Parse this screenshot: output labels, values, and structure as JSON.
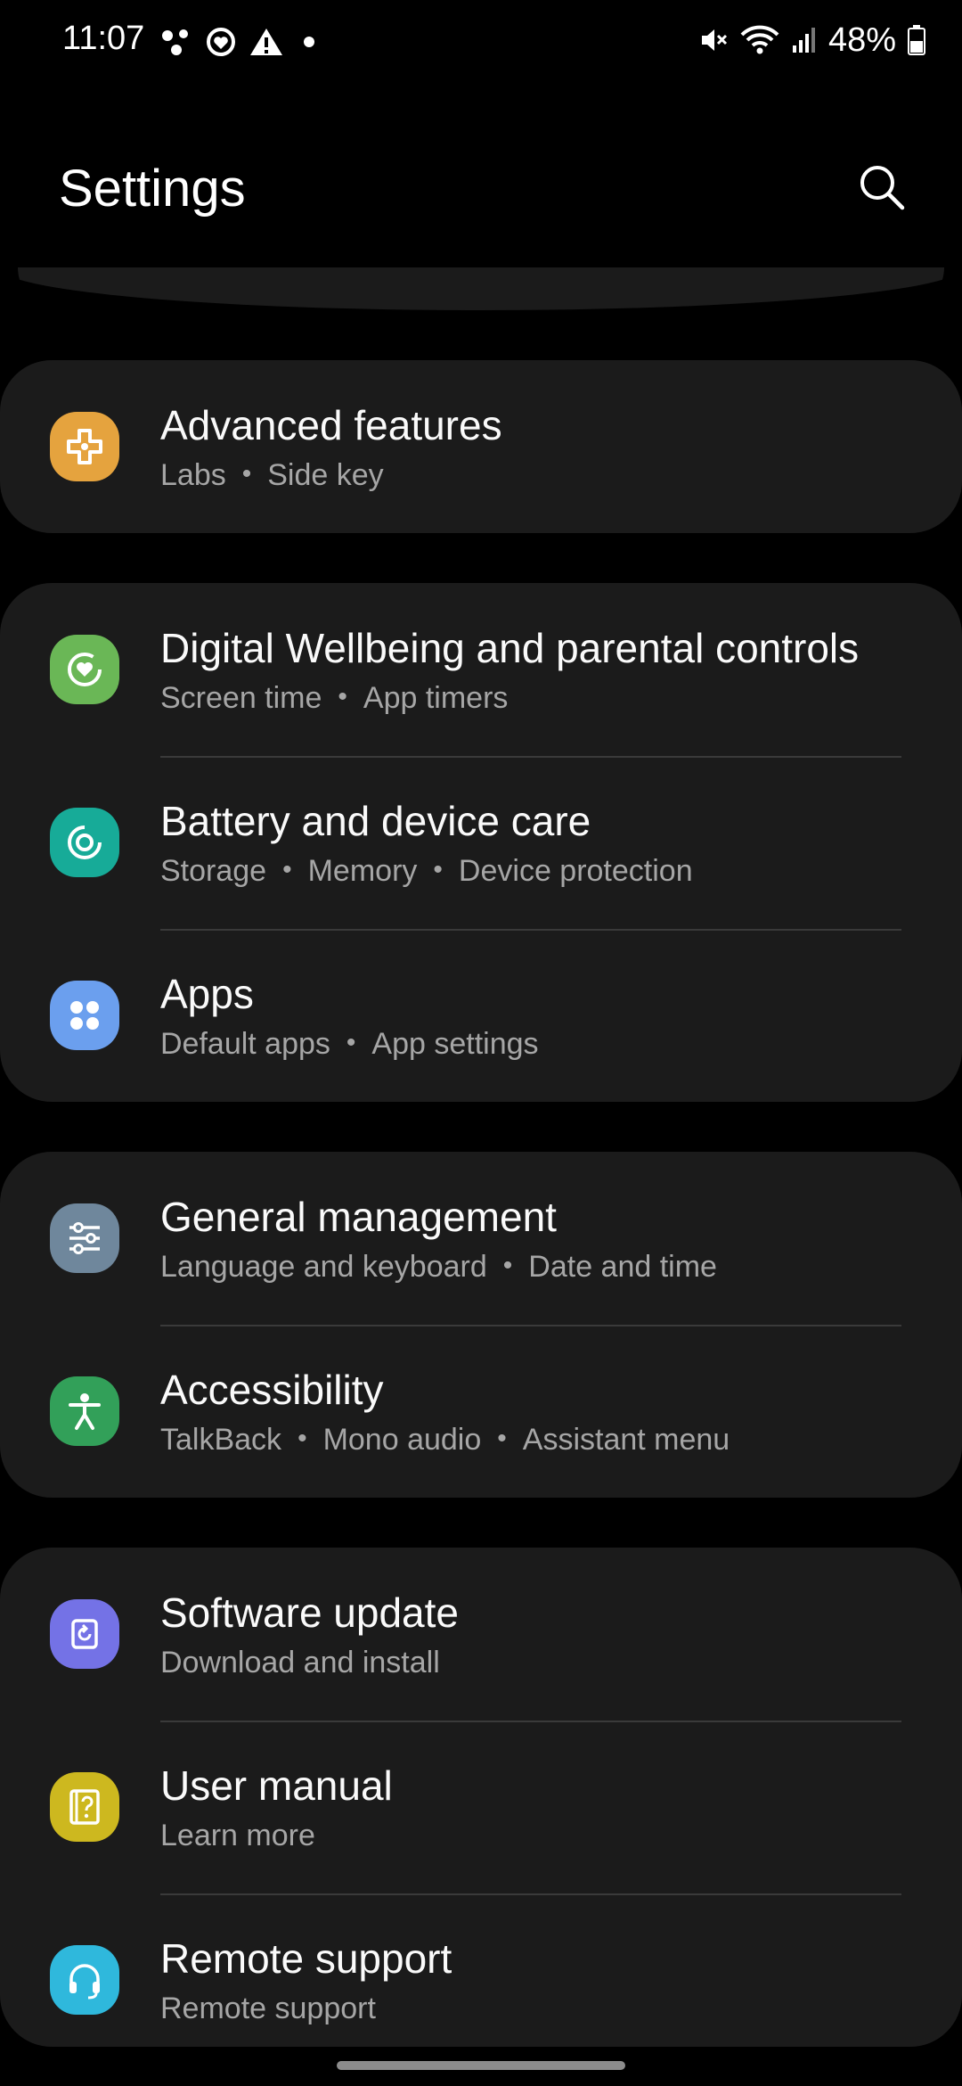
{
  "status": {
    "time": "11:07",
    "battery": "48%"
  },
  "header": {
    "title": "Settings"
  },
  "colors": {
    "background": "#000000",
    "card": "#1b1b1b",
    "advanced": "#e5a33e",
    "wellbeing": "#6ab756",
    "battery_care": "#17ab98",
    "apps": "#6b9fee",
    "general": "#6f879c",
    "accessibility": "#32a059",
    "software": "#7472e6",
    "manual": "#cdb81f",
    "remote": "#2fb8dc"
  },
  "sections": [
    {
      "items": [
        {
          "title": "Advanced features",
          "subtitle": [
            "Labs",
            "Side key"
          ],
          "icon": "puzzle-icon"
        }
      ]
    },
    {
      "items": [
        {
          "title": "Digital Wellbeing and parental controls",
          "subtitle": [
            "Screen time",
            "App timers"
          ],
          "icon": "wellbeing-heart-icon"
        },
        {
          "title": "Battery and device care",
          "subtitle": [
            "Storage",
            "Memory",
            "Device protection"
          ],
          "icon": "device-care-icon"
        },
        {
          "title": "Apps",
          "subtitle": [
            "Default apps",
            "App settings"
          ],
          "icon": "apps-grid-icon"
        }
      ]
    },
    {
      "items": [
        {
          "title": "General management",
          "subtitle": [
            "Language and keyboard",
            "Date and time"
          ],
          "icon": "sliders-icon"
        },
        {
          "title": "Accessibility",
          "subtitle": [
            "TalkBack",
            "Mono audio",
            "Assistant menu"
          ],
          "icon": "accessibility-person-icon"
        }
      ]
    },
    {
      "items": [
        {
          "title": "Software update",
          "subtitle": [
            "Download and install"
          ],
          "icon": "update-icon"
        },
        {
          "title": "User manual",
          "subtitle": [
            "Learn more"
          ],
          "icon": "manual-question-icon"
        },
        {
          "title": "Remote support",
          "subtitle": [
            "Remote support"
          ],
          "icon": "headset-icon"
        }
      ]
    }
  ]
}
